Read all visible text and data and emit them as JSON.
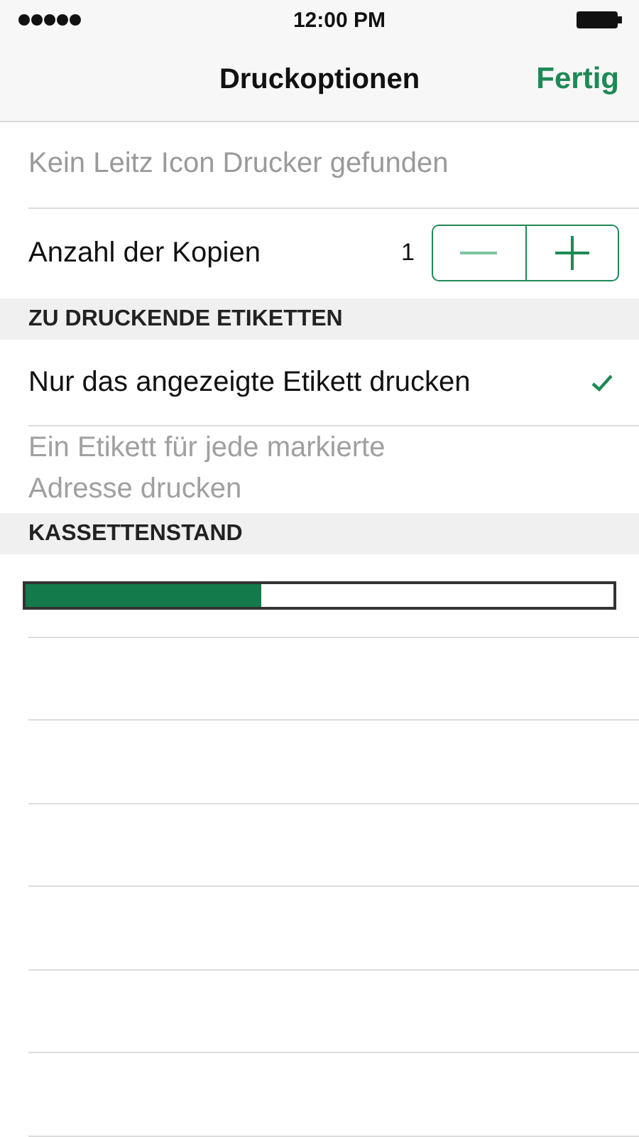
{
  "status_bar": {
    "time": "12:00 PM"
  },
  "nav": {
    "title": "Druckoptionen",
    "done": "Fertig"
  },
  "printer": {
    "text": "Kein Leitz Icon Drucker gefunden",
    "disabled": true
  },
  "copies": {
    "label": "Anzahl der Kopien",
    "value": "1"
  },
  "sections": [
    {
      "header": "ZU DRUCKENDE ETIKETTEN",
      "options": [
        {
          "label": "Nur das angezeigte Etikett drucken",
          "selected": true,
          "disabled": false
        },
        {
          "label": "Ein Etikett für jede markierte Adresse drucken",
          "selected": false,
          "disabled": true
        }
      ]
    },
    {
      "header": "KASSETTENSTAND",
      "level": 0.4
    }
  ]
}
